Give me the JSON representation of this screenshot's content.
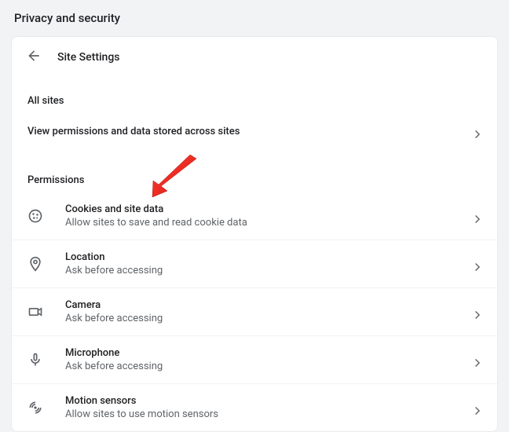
{
  "page": {
    "top_title": "Privacy and security",
    "header_title": "Site Settings",
    "sections": {
      "all_sites": {
        "heading": "All sites",
        "row_title": "View permissions and data stored across sites"
      },
      "permissions": {
        "heading": "Permissions",
        "items": [
          {
            "title": "Cookies and site data",
            "subtitle": "Allow sites to save and read cookie data"
          },
          {
            "title": "Location",
            "subtitle": "Ask before accessing"
          },
          {
            "title": "Camera",
            "subtitle": "Ask before accessing"
          },
          {
            "title": "Microphone",
            "subtitle": "Ask before accessing"
          },
          {
            "title": "Motion sensors",
            "subtitle": "Allow sites to use motion sensors"
          }
        ]
      }
    }
  }
}
